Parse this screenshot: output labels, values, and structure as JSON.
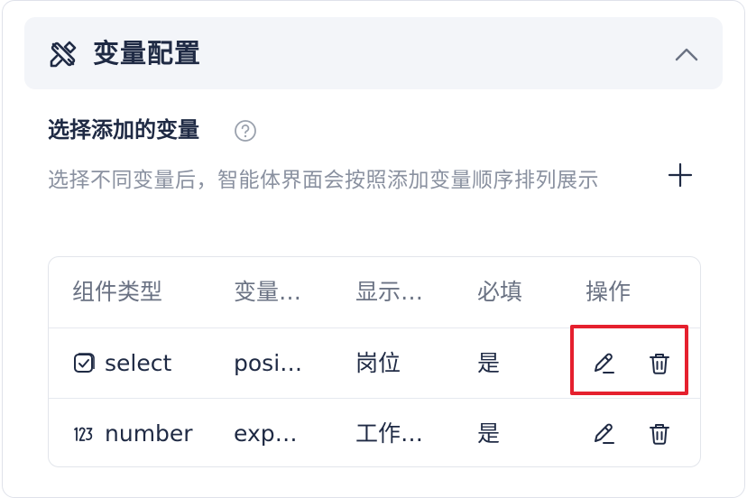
{
  "panel": {
    "title": "变量配置",
    "icon": "tools-cross-icon",
    "collapse_icon": "chevron-up-icon"
  },
  "section": {
    "title": "选择添加的变量",
    "help_icon": "help-circle-icon",
    "description": "选择不同变量后，智能体界面会按照添加变量顺序排列展示",
    "add_icon": "plus-icon"
  },
  "table": {
    "headers": [
      "组件类型",
      "变量…",
      "显示…",
      "必填",
      "操作"
    ],
    "rows": [
      {
        "type_icon": "select-box-icon",
        "type": "select",
        "variable": "posi…",
        "display": "岗位",
        "required": "是"
      },
      {
        "type_icon": "number-123-icon",
        "type": "number",
        "variable": "exp…",
        "display": "工作…",
        "required": "是"
      }
    ],
    "action_icons": [
      "edit-pencil-icon",
      "trash-icon"
    ]
  },
  "colors": {
    "text": "#1f2a44",
    "muted": "#8a91a0",
    "header_bg": "#f3f5f9",
    "highlight": "#e5202e"
  }
}
